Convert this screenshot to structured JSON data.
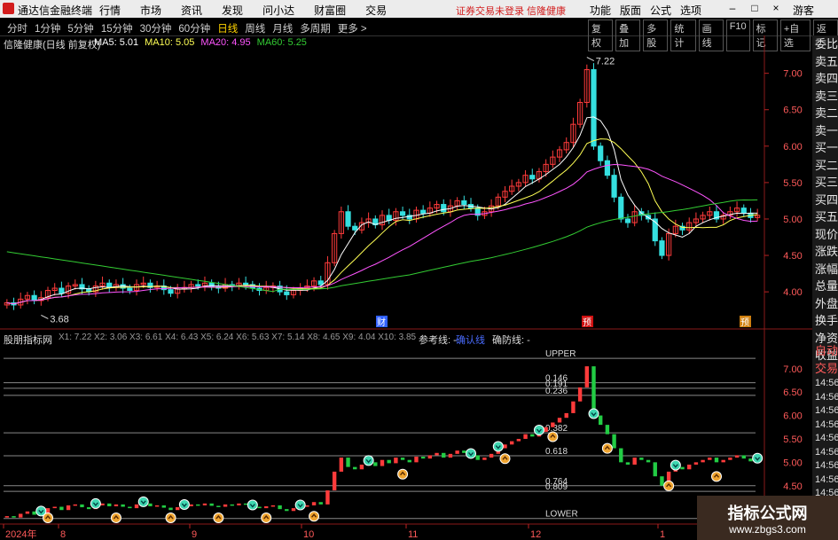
{
  "titlebar": {
    "app_title": "通达信金融终端",
    "menu": [
      "行情",
      "市场",
      "资讯",
      "发现",
      "问小达",
      "财富圈",
      "交易"
    ],
    "notice": "证券交易未登录  信隆健康",
    "right_menu": [
      "功能",
      "版面",
      "公式",
      "选项"
    ],
    "guest": "游客",
    "accent_color": "#d21c1c"
  },
  "toolbar": {
    "periods": [
      "分时",
      "1分钟",
      "5分钟",
      "15分钟",
      "30分钟",
      "60分钟",
      "日线",
      "周线",
      "月线",
      "多周期",
      "更多 >"
    ],
    "active_period": "日线",
    "tools": [
      "复权",
      "叠加",
      "多股",
      "统计",
      "画线",
      "F10",
      "标记",
      "+自选",
      "返回"
    ]
  },
  "main_panel": {
    "stock_label": "信隆健康(日线 前复权)",
    "ma": [
      {
        "label": "MA5: 5.01",
        "color": "#ffffff"
      },
      {
        "label": "MA10: 5.05",
        "color": "#ffff55"
      },
      {
        "label": "MA20: 4.95",
        "color": "#ff55ff"
      },
      {
        "label": "MA60: 5.25",
        "color": "#33cc33"
      }
    ],
    "high_label": "7.22",
    "low_label": "3.68",
    "event_tags": [
      "财",
      "预",
      "预"
    ],
    "y_ticks": [
      "7.00",
      "6.50",
      "6.00",
      "5.50",
      "5.00",
      "4.50",
      "4.00"
    ]
  },
  "indicator_panel": {
    "name": "股朋指标网",
    "values": "X1: 7.22  X2: 3.06  X3: 6.61  X4: 6.43  X5: 6.24  X6: 5.63  X7: 5.14  X8: 4.65  X9: 4.04  X10: 3.85",
    "ref_label": "参考线: -",
    "blue_label": "确认线",
    "confirm_label": "确防线: -",
    "fib_labels": [
      "UPPER",
      "0.146",
      "0.191",
      "0.236",
      "0.382",
      "0.618",
      "0.764",
      "0.809",
      "LOWER"
    ],
    "y_ticks": [
      "7.00",
      "6.50",
      "6.00",
      "5.50",
      "5.00",
      "4.50",
      "4.00"
    ]
  },
  "x_axis": [
    "2024年",
    "8",
    "9",
    "10",
    "11",
    "12",
    "1"
  ],
  "sidebar": {
    "items": [
      "委比",
      "卖五",
      "卖四",
      "卖三",
      "卖二",
      "卖一",
      "买一",
      "买二",
      "买三",
      "买四",
      "买五",
      "现价",
      "涨跌",
      "涨幅",
      "总量",
      "外盘",
      "换手",
      "净资",
      "收益"
    ],
    "lower_items": [
      "自动",
      "交易"
    ],
    "times": [
      "14:56",
      "14:56",
      "14:56",
      "14:56",
      "14:56",
      "14:56",
      "14:56",
      "14:56",
      "14:56"
    ]
  },
  "watermark": {
    "main": "指标公式网",
    "url": "www.zbgs3.com"
  },
  "colors": {
    "up": "#ff3b3b",
    "down": "#35e0e0",
    "ma5": "#ffffff",
    "ma10": "#ffff55",
    "ma20": "#ff55ff",
    "ma60": "#33cc33",
    "fib_line": "#888888"
  },
  "chart_data": {
    "type": "candlestick",
    "series": "daily",
    "closes": [
      3.85,
      3.82,
      3.9,
      3.95,
      3.88,
      3.92,
      4.02,
      4.05,
      3.98,
      4.08,
      4.1,
      4.04,
      4.0,
      4.08,
      4.12,
      4.06,
      4.1,
      4.05,
      4.02,
      4.1,
      4.12,
      4.06,
      4.08,
      4.03,
      3.98,
      4.04,
      4.06,
      4.1,
      4.08,
      4.12,
      4.07,
      4.05,
      4.1,
      4.08,
      4.12,
      4.1,
      4.05,
      4.02,
      4.06,
      4.08,
      4.0,
      3.96,
      4.02,
      4.05,
      4.08,
      4.15,
      4.1,
      4.4,
      4.8,
      5.1,
      4.9,
      4.85,
      4.95,
      5.0,
      4.92,
      5.05,
      4.98,
      5.1,
      5.05,
      5.0,
      5.12,
      5.08,
      5.15,
      5.2,
      5.1,
      5.18,
      5.25,
      5.2,
      5.15,
      5.05,
      5.1,
      5.18,
      5.3,
      5.38,
      5.45,
      5.5,
      5.6,
      5.55,
      5.65,
      5.75,
      5.85,
      5.95,
      6.05,
      6.3,
      6.6,
      7.05,
      6.0,
      5.8,
      5.6,
      5.3,
      5.0,
      4.95,
      5.1,
      5.05,
      5.0,
      4.7,
      4.5,
      4.8,
      4.9,
      4.85,
      4.95,
      5.0,
      5.05,
      5.1,
      5.0,
      5.05,
      5.1,
      5.15,
      5.08,
      5.02,
      5.05
    ],
    "ma_last": {
      "MA5": 5.01,
      "MA10": 5.05,
      "MA20": 4.95,
      "MA60": 5.25
    },
    "high": 7.22,
    "low": 3.68,
    "ylim": [
      3.6,
      7.3
    ]
  }
}
